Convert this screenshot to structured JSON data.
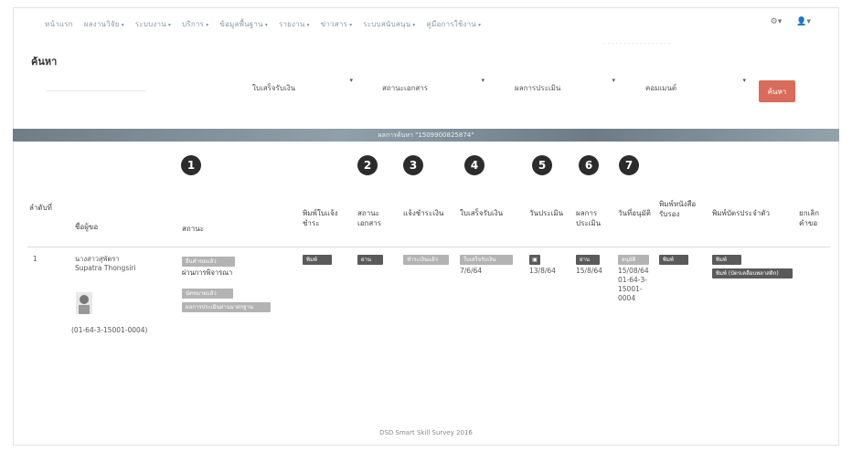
{
  "nav": {
    "items": [
      "หน้าแรก",
      "ผลงานวิจัย",
      "ระบบงาน",
      "บริการ",
      "ข้อมูลพื้นฐาน",
      "รายงาน",
      "ข่าวสาร",
      "ระบบสนับสนุน",
      "คู่มือการใช้งาน"
    ],
    "settings_icon": "gear-icon",
    "user_icon": "user-icon"
  },
  "search": {
    "title": "ค้นหา",
    "placeholder": "",
    "filters": [
      "ใบเสร็จรับเงิน",
      "สถานะเอกสาร",
      "ผลการประเมิน",
      "คอมเมนต์"
    ],
    "button_label": "ค้นหา"
  },
  "banner": {
    "text": "ผลการค้นหา \"1509900825874\""
  },
  "steps": [
    "1",
    "2",
    "3",
    "4",
    "5",
    "6",
    "7"
  ],
  "table": {
    "headers": [
      "ลำดับที่",
      "ชื่อผู้ขอ",
      "สถานะ",
      "พิมพ์ใบแจ้งชำระ",
      "สถานะเอกสาร",
      "แจ้งชำระเงิน",
      "ใบเสร็จรับเงิน",
      "วันประเมิน",
      "ผลการประเมิน",
      "วันที่อนุมัติ",
      "พิมพ์หนังสือรับรอง",
      "พิมพ์บัตรประจำตัว",
      "ยกเลิกคำขอ"
    ],
    "row": {
      "index": "1",
      "name": "นางสาวสุพัตรา",
      "name_en": "Supatra Thongsiri",
      "code": "(01-64-3-15001-0004)",
      "status_tags": [
        "ยื่นคำขอแล้ว",
        "ผ่านการตรวจสอบ",
        "นัดหมายแล้ว",
        "ผลการประเมินผ่านมาตรฐาน"
      ],
      "status_text": "ผ่านการพิจารณา",
      "print_btn": "พิมพ์",
      "doc_btn": "ผ่าน",
      "pay_btn": "ชำระเงินแล้ว",
      "receipt_btn": "ใบเสร็จรับเงิน",
      "receipt_date": "7/6/64",
      "eval_date": "13/8/64",
      "result_btn": "ผ่าน",
      "result_date": "15/8/64",
      "approve_btn": "อนุมัติ",
      "approve_date": "15/08/64",
      "approve_code": "01-64-3-15001-0004",
      "cert_btn": "พิมพ์",
      "card_btn": "พิมพ์",
      "card_btn2": "พิมพ์ (บัตรเคลือบพลาสติก)"
    }
  },
  "footer": "DSD Smart Skill Survey 2016"
}
